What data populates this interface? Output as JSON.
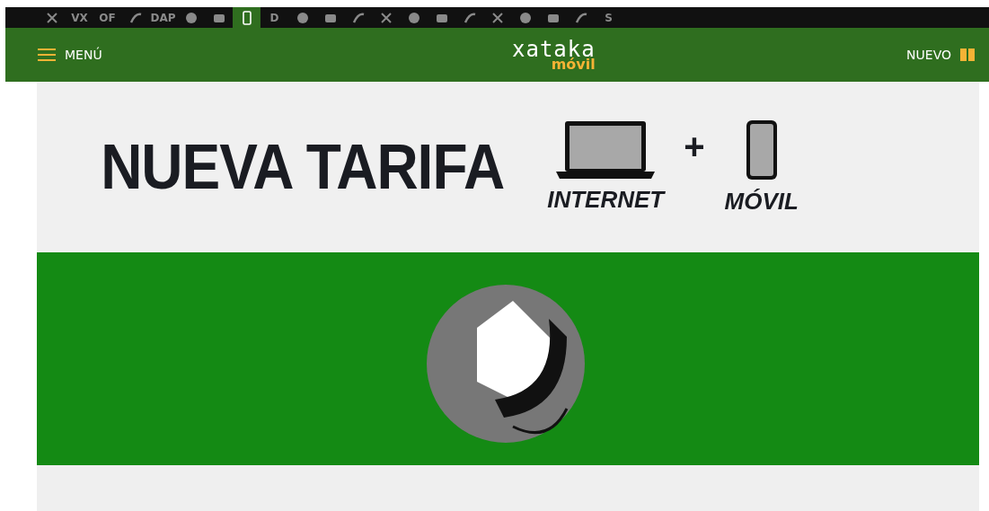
{
  "network_bar": {
    "items": [
      {
        "kind": "icon",
        "selected": false
      },
      {
        "kind": "text",
        "label": "VX",
        "selected": false
      },
      {
        "kind": "text",
        "label": "OF",
        "selected": false
      },
      {
        "kind": "icon",
        "selected": false
      },
      {
        "kind": "text",
        "label": "DAP",
        "selected": false
      },
      {
        "kind": "icon",
        "selected": false
      },
      {
        "kind": "icon",
        "selected": false
      },
      {
        "kind": "icon",
        "selected": true
      },
      {
        "kind": "text",
        "label": "D",
        "selected": false
      },
      {
        "kind": "icon",
        "selected": false
      },
      {
        "kind": "icon",
        "selected": false
      },
      {
        "kind": "icon",
        "selected": false
      },
      {
        "kind": "icon",
        "selected": false
      },
      {
        "kind": "icon",
        "selected": false
      },
      {
        "kind": "icon",
        "selected": false
      },
      {
        "kind": "icon",
        "selected": false
      },
      {
        "kind": "icon",
        "selected": false
      },
      {
        "kind": "icon",
        "selected": false
      },
      {
        "kind": "icon",
        "selected": false
      },
      {
        "kind": "icon",
        "selected": false
      },
      {
        "kind": "text",
        "label": "S",
        "selected": false
      }
    ]
  },
  "header": {
    "menu_label": "MENÚ",
    "logo_text": "xataka",
    "logo_sub": "móvil",
    "new_label": "NUEVO"
  },
  "banner": {
    "headline": "NUEVA TARIFA",
    "plus": "+",
    "left_caption": "INTERNET",
    "right_caption": "MÓVIL"
  }
}
